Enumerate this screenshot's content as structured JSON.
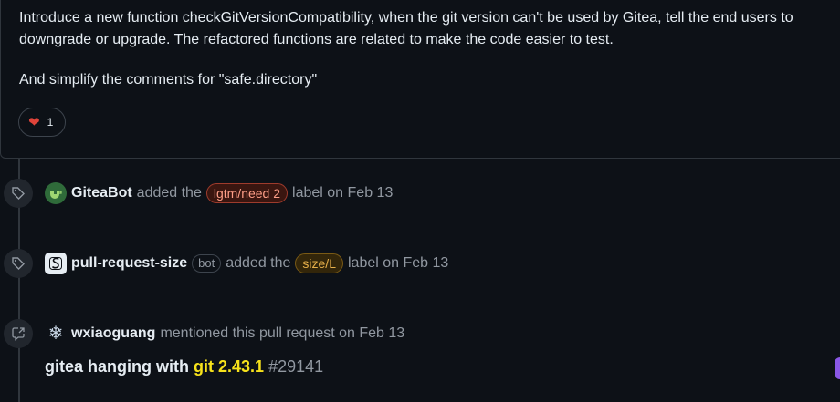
{
  "comment": {
    "paragraph1": "Introduce a new function checkGitVersionCompatibility, when the git version can't be used by Gitea, tell the end users to downgrade or upgrade. The refactored functions are related to make the code easier to test.",
    "paragraph2": "And simplify the comments for \"safe.directory\"",
    "reaction": {
      "emoji": "heart",
      "count": "1"
    }
  },
  "events": [
    {
      "icon": "tag-icon",
      "author": "GiteaBot",
      "before": "added the",
      "label": "lgtm/need 2",
      "after": "label on Feb 13"
    },
    {
      "icon": "tag-icon",
      "author": "pull-request-size",
      "author_tag": "bot",
      "before": "added the",
      "label": "size/L",
      "after": "label on Feb 13"
    },
    {
      "icon": "cross-reference-icon",
      "author": "wxiaoguang",
      "after": "mentioned this pull request on Feb 13",
      "ref": {
        "title_prefix": "gitea hanging with",
        "title_highlight": "git 2.43.1",
        "number": "#29141"
      }
    }
  ],
  "colors": {
    "background": "#0d1117",
    "lgtm_label": "#ff9f88",
    "size_label": "#e7b04a",
    "highlight": "#f7e21b",
    "heart": "#e0443a"
  }
}
